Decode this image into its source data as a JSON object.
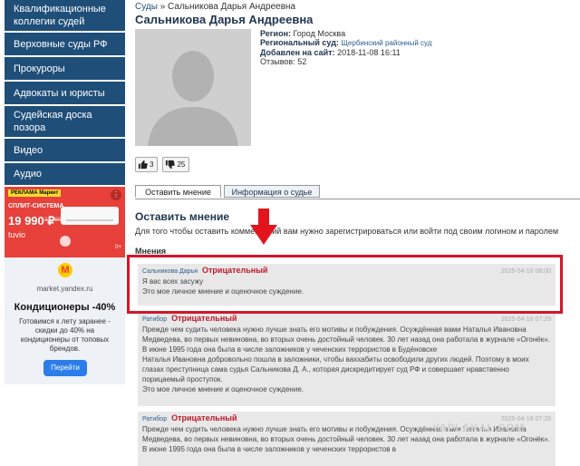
{
  "sidebar": {
    "items": [
      {
        "label": "Квалификационные коллегии судей"
      },
      {
        "label": "Верховные суды РФ"
      },
      {
        "label": "Прокуроры"
      },
      {
        "label": "Адвокаты и юристы"
      },
      {
        "label": "Судейская доска позора"
      },
      {
        "label": "Видео"
      },
      {
        "label": "Аудио"
      }
    ]
  },
  "ad": {
    "tag": "РЕКЛАМА Маркет",
    "category": "СПЛИТ-СИСТЕМА",
    "price": "19 990 ₽",
    "old_price": "31 990",
    "brand": "tuvio",
    "age": "0+",
    "logo": "М",
    "domain": "market.yandex.ru",
    "title": "Кондиционеры -40%",
    "text": "Готовимся к лету заранее - скидки до 40% на кондиционеры от топовых брендов.",
    "button": "Перейти"
  },
  "breadcrumb": {
    "root": "Суды",
    "separator": "»",
    "current": "Сальникова Дарья Андреевна"
  },
  "judge": {
    "name": "Сальникова Дарья Андреевна",
    "region_label": "Регион:",
    "region": "Город Москва",
    "court_label": "Региональный суд:",
    "court": "Щербинский районный суд",
    "added_label": "Добавлен на сайт:",
    "added": "2018-11-08 16:11",
    "reviews_label": "Отзывов:",
    "reviews": "52"
  },
  "votes": {
    "likes": "3",
    "dislikes": "25"
  },
  "tabs": [
    {
      "label": "Оставить мнение"
    },
    {
      "label": "Информация о судье"
    }
  ],
  "form": {
    "title": "Оставить мнение",
    "notice": "Для того чтобы оставить комментарий вам нужно зарегистрироваться или войти под своим логином и паролем"
  },
  "opinions": {
    "heading": "Мнения",
    "items": [
      {
        "author": "Сальникова Дарья",
        "type": "Отрицательный",
        "date": "2025-04-16 08:00",
        "paragraphs": [
          "Я вас всех засужу",
          "Это мое личное мнение и оценочное суждение."
        ]
      },
      {
        "author": "Ратибор",
        "type": "Отрицательный",
        "date": "2025-04-16 07:29",
        "paragraphs": [
          "Прежде чем судить человека нужно лучше знать его мотивы и побуждения. Осуждённая вами Наталья Ивановна Медведева, во первых невиновна, во вторых очень достойный человек. 30 лет назад она работала в журнале «Огонёк». В июне 1995 года она была в числе заложников у чеченских террористов в Будёновске",
          "Наталья Ивановна добровольно пошла в заложники, чтобы ваххабиты освободили других людей. Поэтому в моих глазах преступница сама судья Сальникова Д. А., которая дискредитирует суд РФ и совершает нравственно порицаемый проступок.",
          "Это мое личное мнение и оценочное суждение."
        ]
      },
      {
        "author": "Ратибор",
        "type": "Отрицательный",
        "date": "2025-04-16 07:29",
        "paragraphs": [
          "Прежде чем судить человека нужно лучше знать его мотивы и побуждения. Осуждённая вами Наталья Ивановна Медведева, во первых невиновна, во вторых очень достойный человек. 30 лет назад она работала в журнале «Огонёк». В июне 1995 года она была в числе заложников у чеченских террористов в"
        ]
      }
    ]
  },
  "watermark": "YAPLAKAL.COM",
  "colors": {
    "nav_bg": "#1f4e79",
    "highlight": "#d3162a",
    "negative": "#c0182a",
    "accent_red": "#e8403a"
  }
}
